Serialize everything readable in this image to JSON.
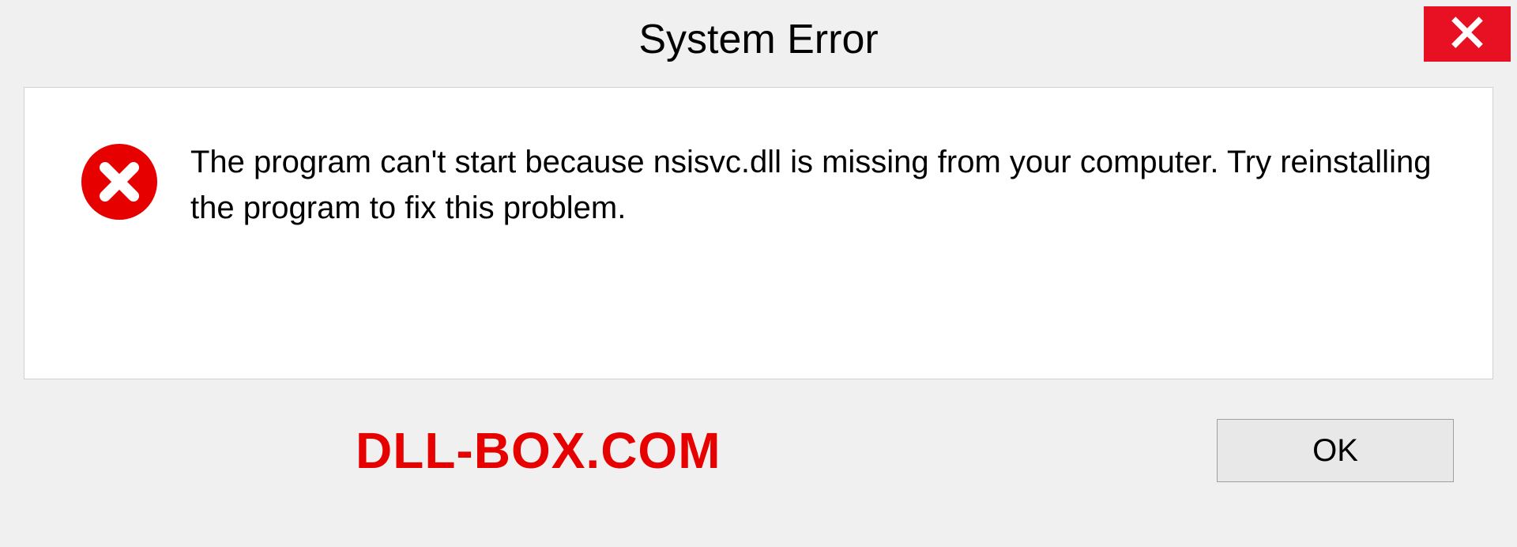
{
  "title": "System Error",
  "message": "The program can't start because nsisvc.dll is missing from your computer. Try reinstalling the program to fix this problem.",
  "watermark": "DLL-BOX.COM",
  "ok_label": "OK",
  "colors": {
    "close_bg": "#e81123",
    "error_icon": "#e60000",
    "watermark": "#e60000"
  }
}
